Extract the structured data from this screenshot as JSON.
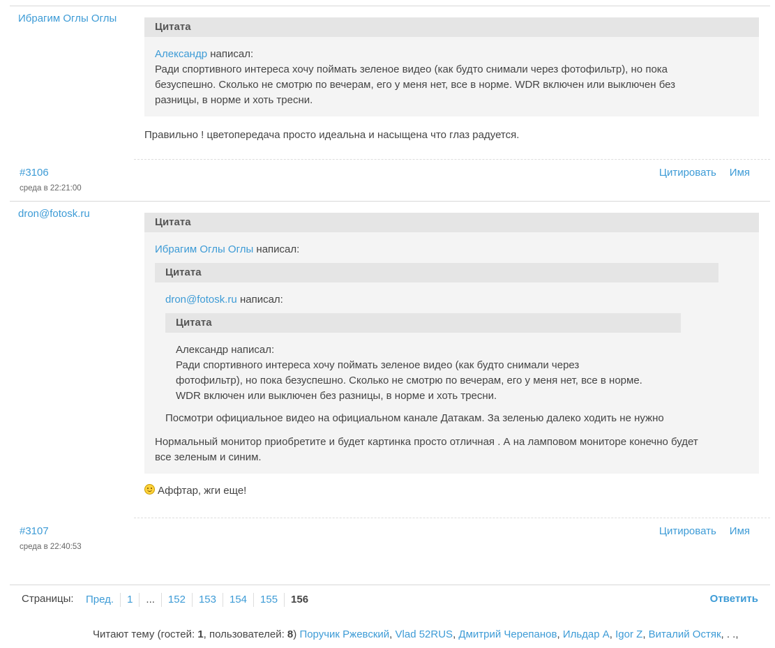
{
  "posts": [
    {
      "author": "Ибрагим Оглы Оглы",
      "quote_label": "Цитата",
      "quote_author": "Александр",
      "wrote": "написал:",
      "quote_lines": [
        "Ради спортивного интереса хочу поймать зеленое видео (как будто снимали через фотофильтр), но пока",
        "безуспешно. Сколько не смотрю по вечерам, его у меня нет, все в норме. WDR включен или выключен без",
        "разницы, в норме и хоть тресни."
      ],
      "message": "Правильно ! цветопередача просто идеальна и насыщена что глаз радуется.",
      "number": "#3106",
      "time": "среда в 22:21:00"
    },
    {
      "author": "dron@fotosk.ru",
      "quote_label": "Цитата",
      "quote_author": "Ибрагим Оглы Оглы",
      "wrote": "написал:",
      "nested_quote_author": "dron@fotosk.ru",
      "deep_quote_lines": [
        "Александр написал:",
        "Ради спортивного интереса хочу поймать зеленое видео (как будто снимали через",
        "фотофильтр), но пока безуспешно. Сколько не смотрю по вечерам, его у меня нет, все в норме.",
        "WDR включен или выключен без разницы, в норме и хоть тресни."
      ],
      "nested_text": "Посмотри официальное видео на официальном канале Датакам. За зеленью далеко ходить не нужно",
      "quote_text_lines": [
        "Нормальный монитор приобретите и будет картинка просто отличная . А на ламповом мониторе конечно будет",
        "все зеленым и синим."
      ],
      "message": "Аффтар, жги еще!",
      "number": "#3107",
      "time": "среда в 22:40:53"
    }
  ],
  "actions": {
    "quote": "Цитировать",
    "name": "Имя"
  },
  "pager": {
    "label": "Страницы:",
    "prev": "Пред.",
    "pages": [
      "1",
      "...",
      "152",
      "153",
      "154",
      "155"
    ],
    "current": "156",
    "reply": "Ответить"
  },
  "readers": {
    "prefix": "Читают тему (гостей: ",
    "guests": "1",
    "mid": ", пользователей: ",
    "users": "8",
    "suffix": ")",
    "names": [
      "Поручик Ржевский",
      "Vlad 52RUS",
      "Дмитрий Черепанов",
      "Ильдар А",
      "Igor Z",
      "Виталий Остяк"
    ],
    "tail": ", . .,"
  }
}
